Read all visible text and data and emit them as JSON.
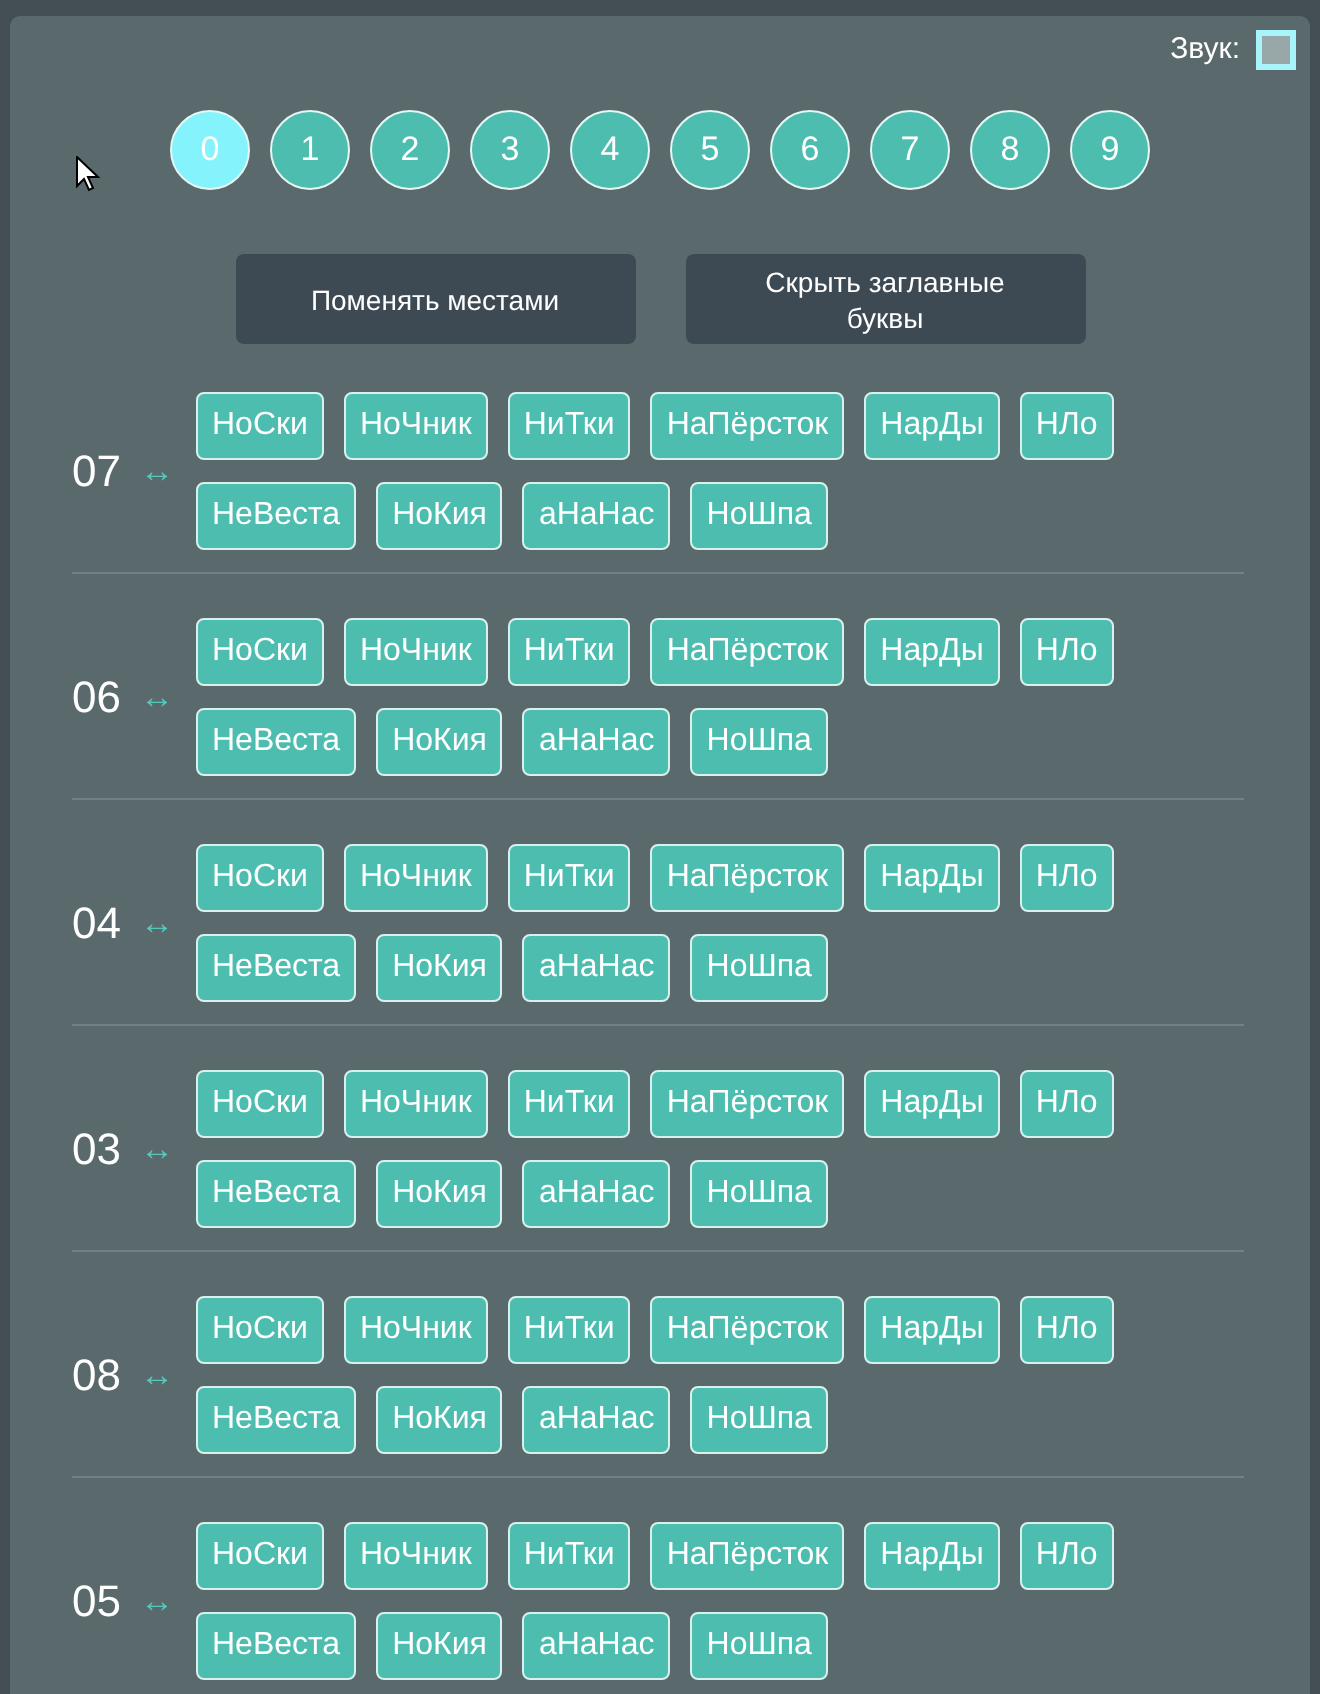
{
  "sound": {
    "label": "Звук:",
    "checked": false
  },
  "digits": [
    {
      "label": "0",
      "selected": true
    },
    {
      "label": "1",
      "selected": false
    },
    {
      "label": "2",
      "selected": false
    },
    {
      "label": "3",
      "selected": false
    },
    {
      "label": "4",
      "selected": false
    },
    {
      "label": "5",
      "selected": false
    },
    {
      "label": "6",
      "selected": false
    },
    {
      "label": "7",
      "selected": false
    },
    {
      "label": "8",
      "selected": false
    },
    {
      "label": "9",
      "selected": false
    }
  ],
  "buttons": [
    "Поменять местами",
    "Скрыть заглавные буквы"
  ],
  "groups": [
    {
      "number": "07",
      "arrow": "↔",
      "rows": [
        [
          "НоСки",
          "НоЧник",
          "НиТки",
          "НаПёрсток",
          "НарДы",
          "НЛо"
        ],
        [
          "НеВеста",
          "НоКия",
          "аНаНас",
          "НоШпа"
        ]
      ]
    },
    {
      "number": "06",
      "arrow": "↔",
      "rows": [
        [
          "НоСки",
          "НоЧник",
          "НиТки",
          "НаПёрсток",
          "НарДы",
          "НЛо"
        ],
        [
          "НеВеста",
          "НоКия",
          "аНаНас",
          "НоШпа"
        ]
      ]
    },
    {
      "number": "04",
      "arrow": "↔",
      "rows": [
        [
          "НоСки",
          "НоЧник",
          "НиТки",
          "НаПёрсток",
          "НарДы",
          "НЛо"
        ],
        [
          "НеВеста",
          "НоКия",
          "аНаНас",
          "НоШпа"
        ]
      ]
    },
    {
      "number": "03",
      "arrow": "↔",
      "rows": [
        [
          "НоСки",
          "НоЧник",
          "НиТки",
          "НаПёрсток",
          "НарДы",
          "НЛо"
        ],
        [
          "НеВеста",
          "НоКия",
          "аНаНас",
          "НоШпа"
        ]
      ]
    },
    {
      "number": "08",
      "arrow": "↔",
      "rows": [
        [
          "НоСки",
          "НоЧник",
          "НиТки",
          "НаПёрсток",
          "НарДы",
          "НЛо"
        ],
        [
          "НеВеста",
          "НоКия",
          "аНаНас",
          "НоШпа"
        ]
      ]
    },
    {
      "number": "05",
      "arrow": "↔",
      "rows": [
        [
          "НоСки",
          "НоЧник",
          "НиТки",
          "НаПёрсток",
          "НарДы",
          "НЛо"
        ],
        [
          "НеВеста",
          "НоКия",
          "аНаНас",
          "НоШпа"
        ]
      ]
    }
  ]
}
